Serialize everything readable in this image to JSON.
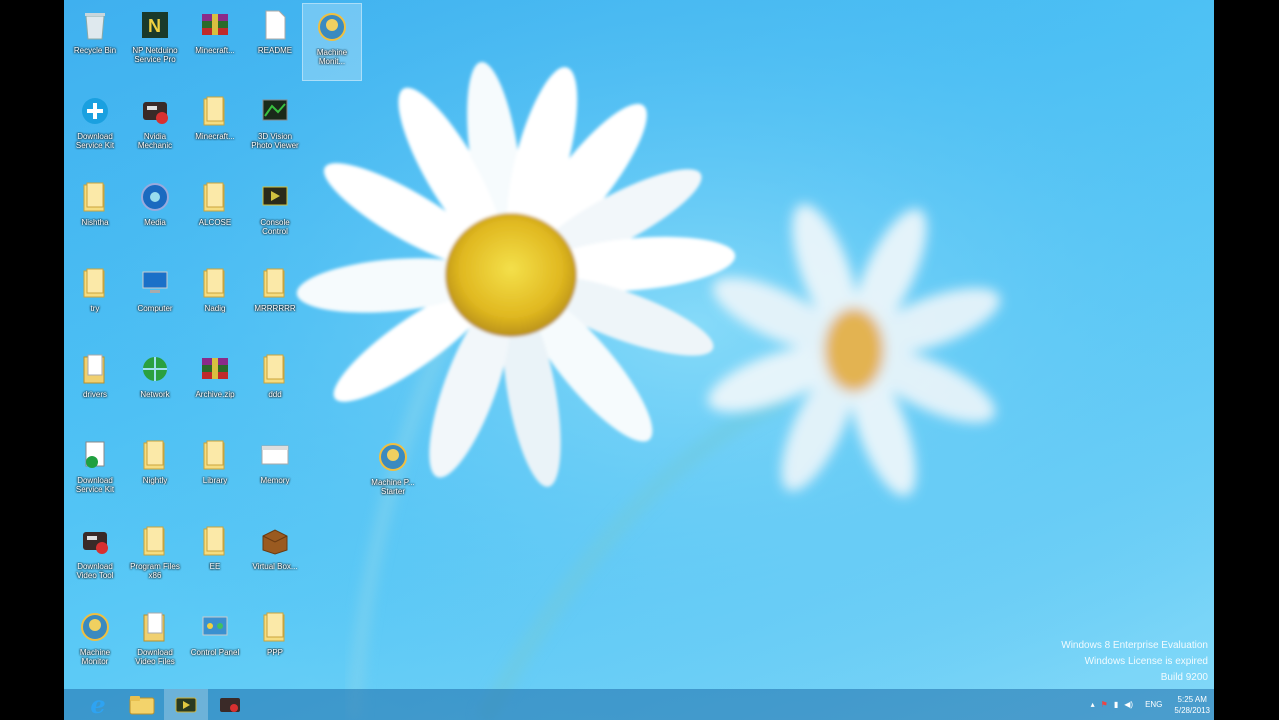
{
  "desktop": {
    "icons": [
      {
        "label": "Recycle Bin",
        "type": "recycle"
      },
      {
        "label": "NP Netduino Service Pro",
        "type": "app-n"
      },
      {
        "label": "Minecraft...",
        "type": "archive"
      },
      {
        "label": "README",
        "type": "file"
      },
      {
        "label": "Machine Monit...",
        "type": "disc-app"
      },
      {
        "label": "Download Service Kit",
        "type": "plus-app"
      },
      {
        "label": "Nvidia Mechanic",
        "type": "tools-app"
      },
      {
        "label": "Minecraft...",
        "type": "folder"
      },
      {
        "label": "3D Vision Photo Viewer",
        "type": "viewer-app"
      },
      {
        "label": "Nishtha",
        "type": "folder"
      },
      {
        "label": "Media",
        "type": "media-app"
      },
      {
        "label": "ALCOSE",
        "type": "folder"
      },
      {
        "label": "Console Control",
        "type": "console-app"
      },
      {
        "label": "try",
        "type": "folder"
      },
      {
        "label": "Computer",
        "type": "computer"
      },
      {
        "label": "Nadig",
        "type": "folder"
      },
      {
        "label": "MRRRRRR",
        "type": "folder"
      },
      {
        "label": "drivers",
        "type": "folder-doc"
      },
      {
        "label": "Network",
        "type": "network"
      },
      {
        "label": "Archive.zip",
        "type": "archive"
      },
      {
        "label": "ddd",
        "type": "folder"
      },
      {
        "label": "Download Service Kit",
        "type": "doc-app"
      },
      {
        "label": "Nightly",
        "type": "folder"
      },
      {
        "label": "Library",
        "type": "folder"
      },
      {
        "label": "Memory",
        "type": "window"
      },
      {
        "label": "Download Video Tool",
        "type": "tools-app"
      },
      {
        "label": "Program Files x86",
        "type": "folder"
      },
      {
        "label": "EE",
        "type": "folder"
      },
      {
        "label": "Virtual Box...",
        "type": "box-app"
      },
      {
        "label": "Machine Monitor",
        "type": "disc-app"
      },
      {
        "label": "Download Video Files",
        "type": "folder-doc"
      },
      {
        "label": "Control Panel",
        "type": "control"
      },
      {
        "label": "PPP",
        "type": "folder"
      },
      {
        "label": "Machine P... Starter",
        "type": "disc-app"
      }
    ]
  },
  "watermark": {
    "line1": "Windows 8 Enterprise Evaluation",
    "line2": "Windows License is expired",
    "line3": "Build 9200"
  },
  "taskbar": {
    "apps": [
      {
        "name": "internet-explorer",
        "active": false
      },
      {
        "name": "file-explorer",
        "active": false
      },
      {
        "name": "video-app",
        "active": true
      },
      {
        "name": "tools-app",
        "active": false
      }
    ],
    "tray": {
      "language": "ENG",
      "time": "5:25 AM",
      "date": "5/28/2013"
    }
  }
}
